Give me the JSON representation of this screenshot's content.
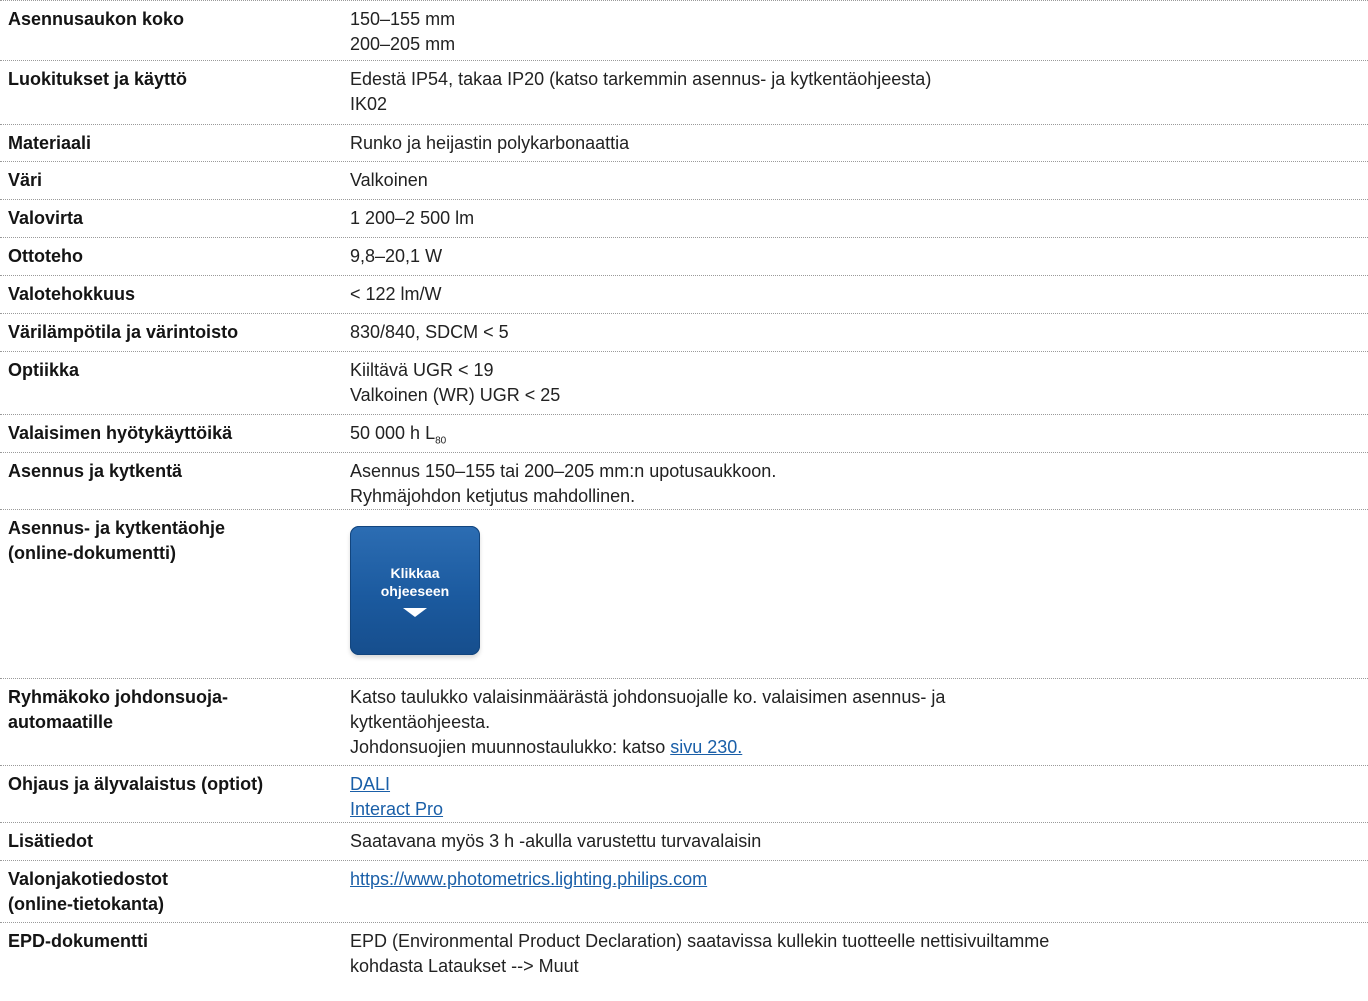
{
  "rows": [
    {
      "label": "Asennusaukon koko",
      "lines": [
        "150–155 mm",
        "200–205 mm"
      ]
    },
    {
      "label": "Luokitukset ja käyttö",
      "lines": [
        "Edestä IP54, takaa IP20 (katso tarkemmin asennus- ja kytkentäohjeesta)",
        "IK02"
      ]
    },
    {
      "label": "Materiaali",
      "lines": [
        "Runko ja heijastin polykarbonaattia"
      ]
    },
    {
      "label": "Väri",
      "lines": [
        "Valkoinen"
      ]
    },
    {
      "label": "Valovirta",
      "lines": [
        "1 200–2 500 lm"
      ]
    },
    {
      "label": "Ottoteho",
      "lines": [
        "9,8–20,1 W"
      ]
    },
    {
      "label": "Valotehokkuus",
      "lines": [
        "< 122 lm/W"
      ]
    },
    {
      "label": "Värilämpötila ja värintoisto",
      "lines": [
        "830/840, SDCM < 5"
      ]
    },
    {
      "label": "Optiikka",
      "lines": [
        "Kiiltävä UGR < 19",
        "Valkoinen (WR) UGR < 25"
      ]
    },
    {
      "label": "Valaisimen hyötykäyttöikä",
      "value_main": "50 000 h L",
      "value_sub": "80"
    },
    {
      "label": "Asennus ja kytkentä",
      "lines": [
        "Asennus 150–155 tai 200–205 mm:n upotusaukkoon.",
        "Ryhmäjohdon ketjutus mahdollinen."
      ]
    },
    {
      "label_lines": [
        "Asennus- ja kytkentäohje",
        "(online-dokumentti)"
      ],
      "button_lines": [
        "Klikkaa",
        "ohjeeseen"
      ]
    },
    {
      "label_lines": [
        "Ryhmäkoko johdonsuoja-",
        "automaatille"
      ],
      "lines": [
        "Katso taulukko valaisinmäärästä johdonsuojalle ko. valaisimen asennus- ja",
        "kytkentäohjeesta."
      ],
      "ref_prefix": "Johdonsuojien muunnostaulukko: katso ",
      "ref_link": "sivu 230."
    },
    {
      "label": "Ohjaus ja älyvalaistus (optiot)",
      "links": [
        "DALI",
        "Interact Pro"
      ]
    },
    {
      "label": "Lisätiedot",
      "lines": [
        "Saatavana myös 3 h -akulla varustettu turvavalaisin"
      ]
    },
    {
      "label_lines": [
        "Valonjakotiedostot",
        "(online-tietokanta)"
      ],
      "links": [
        "https://www.photometrics.lighting.philips.com"
      ]
    },
    {
      "label": "EPD-dokumentti",
      "lines": [
        "EPD (Environmental Product Declaration) saatavissa kullekin tuotteelle nettisivuiltamme",
        "kohdasta Lataukset --> Muut"
      ]
    }
  ]
}
